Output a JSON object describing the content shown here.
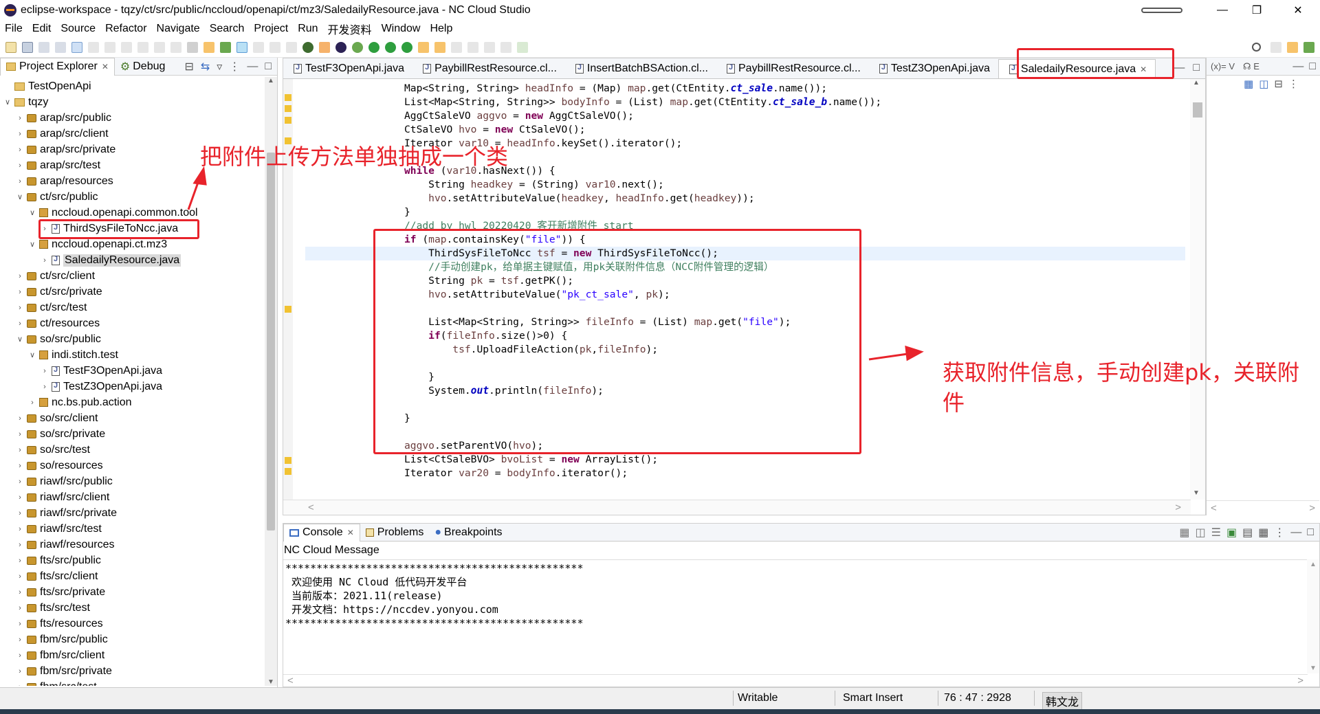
{
  "window": {
    "title": "eclipse-workspace - tqzy/ct/src/public/nccloud/openapi/ct/mz3/SaledailyResource.java - NC Cloud Studio"
  },
  "menu": [
    "File",
    "Edit",
    "Source",
    "Refactor",
    "Navigate",
    "Search",
    "Project",
    "Run",
    "开发资料",
    "Window",
    "Help"
  ],
  "left_panel": {
    "tabs": [
      "Project Explorer",
      "Debug"
    ],
    "tree": [
      {
        "label": "TestOpenApi",
        "icon": "project",
        "level": 0,
        "twist": ""
      },
      {
        "label": "tqzy",
        "icon": "project",
        "level": 0,
        "twist": "v"
      },
      {
        "label": "arap/src/public",
        "icon": "srcfolder",
        "level": 1,
        "twist": ">"
      },
      {
        "label": "arap/src/client",
        "icon": "srcfolder",
        "level": 1,
        "twist": ">"
      },
      {
        "label": "arap/src/private",
        "icon": "srcfolder",
        "level": 1,
        "twist": ">"
      },
      {
        "label": "arap/src/test",
        "icon": "srcfolder",
        "level": 1,
        "twist": ">"
      },
      {
        "label": "arap/resources",
        "icon": "srcfolder",
        "level": 1,
        "twist": ">"
      },
      {
        "label": "ct/src/public",
        "icon": "srcfolder",
        "level": 1,
        "twist": "v"
      },
      {
        "label": "nccloud.openapi.common.tool",
        "icon": "package",
        "level": 2,
        "twist": "v"
      },
      {
        "label": "ThirdSysFileToNcc.java",
        "icon": "java",
        "level": 3,
        "twist": ">"
      },
      {
        "label": "nccloud.openapi.ct.mz3",
        "icon": "package",
        "level": 2,
        "twist": "v"
      },
      {
        "label": "SaledailyResource.java",
        "icon": "java",
        "level": 3,
        "twist": ">",
        "selected": true
      },
      {
        "label": "ct/src/client",
        "icon": "srcfolder",
        "level": 1,
        "twist": ">"
      },
      {
        "label": "ct/src/private",
        "icon": "srcfolder",
        "level": 1,
        "twist": ">"
      },
      {
        "label": "ct/src/test",
        "icon": "srcfolder",
        "level": 1,
        "twist": ">"
      },
      {
        "label": "ct/resources",
        "icon": "srcfolder",
        "level": 1,
        "twist": ">"
      },
      {
        "label": "so/src/public",
        "icon": "srcfolder",
        "level": 1,
        "twist": "v"
      },
      {
        "label": "indi.stitch.test",
        "icon": "package",
        "level": 2,
        "twist": "v"
      },
      {
        "label": "TestF3OpenApi.java",
        "icon": "java",
        "level": 3,
        "twist": ">"
      },
      {
        "label": "TestZ3OpenApi.java",
        "icon": "java",
        "level": 3,
        "twist": ">"
      },
      {
        "label": "nc.bs.pub.action",
        "icon": "package",
        "level": 2,
        "twist": ">"
      },
      {
        "label": "so/src/client",
        "icon": "srcfolder",
        "level": 1,
        "twist": ">"
      },
      {
        "label": "so/src/private",
        "icon": "srcfolder",
        "level": 1,
        "twist": ">"
      },
      {
        "label": "so/src/test",
        "icon": "srcfolder",
        "level": 1,
        "twist": ">"
      },
      {
        "label": "so/resources",
        "icon": "srcfolder",
        "level": 1,
        "twist": ">"
      },
      {
        "label": "riawf/src/public",
        "icon": "srcfolder",
        "level": 1,
        "twist": ">"
      },
      {
        "label": "riawf/src/client",
        "icon": "srcfolder",
        "level": 1,
        "twist": ">"
      },
      {
        "label": "riawf/src/private",
        "icon": "srcfolder",
        "level": 1,
        "twist": ">"
      },
      {
        "label": "riawf/src/test",
        "icon": "srcfolder",
        "level": 1,
        "twist": ">"
      },
      {
        "label": "riawf/resources",
        "icon": "srcfolder",
        "level": 1,
        "twist": ">"
      },
      {
        "label": "fts/src/public",
        "icon": "srcfolder",
        "level": 1,
        "twist": ">"
      },
      {
        "label": "fts/src/client",
        "icon": "srcfolder",
        "level": 1,
        "twist": ">"
      },
      {
        "label": "fts/src/private",
        "icon": "srcfolder",
        "level": 1,
        "twist": ">"
      },
      {
        "label": "fts/src/test",
        "icon": "srcfolder",
        "level": 1,
        "twist": ">"
      },
      {
        "label": "fts/resources",
        "icon": "srcfolder",
        "level": 1,
        "twist": ">"
      },
      {
        "label": "fbm/src/public",
        "icon": "srcfolder",
        "level": 1,
        "twist": ">"
      },
      {
        "label": "fbm/src/client",
        "icon": "srcfolder",
        "level": 1,
        "twist": ">"
      },
      {
        "label": "fbm/src/private",
        "icon": "srcfolder",
        "level": 1,
        "twist": ">"
      },
      {
        "label": "fbm/src/test",
        "icon": "srcfolder",
        "level": 1,
        "twist": ">"
      }
    ]
  },
  "editor": {
    "tabs": [
      "TestF3OpenApi.java",
      "PaybillRestResource.cl...",
      "InsertBatchBSAction.cl...",
      "PaybillRestResource.cl...",
      "TestZ3OpenApi.java",
      "SaledailyResource.java"
    ],
    "active_tab": 5,
    "code": [
      [
        [
          "",
          "Map<String, String> "
        ],
        [
          "var",
          "headInfo"
        ],
        [
          "",
          " = (Map) "
        ],
        [
          "var",
          "map"
        ],
        [
          "",
          ".get(CtEntity."
        ],
        [
          "fld",
          "ct_sale"
        ],
        [
          "",
          ".name());"
        ]
      ],
      [
        [
          "",
          "List<Map<String, String>> "
        ],
        [
          "var",
          "bodyInfo"
        ],
        [
          "",
          " = (List) "
        ],
        [
          "var",
          "map"
        ],
        [
          "",
          ".get(CtEntity."
        ],
        [
          "fld",
          "ct_sale_b"
        ],
        [
          "",
          ".name());"
        ]
      ],
      [
        [
          "",
          "AggCtSaleVO "
        ],
        [
          "var",
          "aggvo"
        ],
        [
          "",
          " = "
        ],
        [
          "kw",
          "new"
        ],
        [
          "",
          " AggCtSaleVO();"
        ]
      ],
      [
        [
          "",
          "CtSaleVO "
        ],
        [
          "var",
          "hvo"
        ],
        [
          "",
          " = "
        ],
        [
          "kw",
          "new"
        ],
        [
          "",
          " CtSaleVO();"
        ]
      ],
      [
        [
          "",
          "Iterator "
        ],
        [
          "var",
          "var10"
        ],
        [
          "",
          " = "
        ],
        [
          "var",
          "headInfo"
        ],
        [
          "",
          ".keySet().iterator();"
        ]
      ],
      [
        [
          "",
          ""
        ]
      ],
      [
        [
          "kw",
          "while"
        ],
        [
          "",
          " ("
        ],
        [
          "var",
          "var10"
        ],
        [
          "",
          ".hasNext()) {"
        ]
      ],
      [
        [
          "",
          "    String "
        ],
        [
          "var",
          "headkey"
        ],
        [
          "",
          " = (String) "
        ],
        [
          "var",
          "var10"
        ],
        [
          "",
          ".next();"
        ]
      ],
      [
        [
          "",
          "    "
        ],
        [
          "var",
          "hvo"
        ],
        [
          "",
          ".setAttributeValue("
        ],
        [
          "var",
          "headkey"
        ],
        [
          "",
          ", "
        ],
        [
          "var",
          "headInfo"
        ],
        [
          "",
          ".get("
        ],
        [
          "var",
          "headkey"
        ],
        [
          "",
          "));"
        ]
      ],
      [
        [
          "",
          "}"
        ]
      ],
      [
        [
          "cm",
          "//add by hwl 20220420 客开新增附件 start"
        ]
      ],
      [
        [
          "kw",
          "if"
        ],
        [
          "",
          " ("
        ],
        [
          "var",
          "map"
        ],
        [
          "",
          ".containsKey("
        ],
        [
          "st",
          "\"file\""
        ],
        [
          "",
          ")) {"
        ]
      ],
      [
        [
          "",
          "    ThirdSysFileToNcc "
        ],
        [
          "var",
          "tsf"
        ],
        [
          "",
          " = "
        ],
        [
          "kw",
          "new"
        ],
        [
          "",
          " ThirdSysFileToNcc();"
        ]
      ],
      [
        [
          "cm",
          "    //手动创建pk，给单据主键赋值，用pk关联附件信息（NCC附件管理的逻辑）"
        ]
      ],
      [
        [
          "",
          "    String "
        ],
        [
          "var",
          "pk"
        ],
        [
          "",
          " = "
        ],
        [
          "var",
          "tsf"
        ],
        [
          "",
          ".getPK();"
        ]
      ],
      [
        [
          "",
          "    "
        ],
        [
          "var",
          "hvo"
        ],
        [
          "",
          ".setAttributeValue("
        ],
        [
          "st",
          "\"pk_ct_sale\""
        ],
        [
          "",
          ", "
        ],
        [
          "var",
          "pk"
        ],
        [
          "",
          ");"
        ]
      ],
      [
        [
          "",
          ""
        ]
      ],
      [
        [
          "",
          "    List<Map<String, String>> "
        ],
        [
          "var",
          "fileInfo"
        ],
        [
          "",
          " = (List) "
        ],
        [
          "var",
          "map"
        ],
        [
          "",
          ".get("
        ],
        [
          "st",
          "\"file\""
        ],
        [
          "",
          ");"
        ]
      ],
      [
        [
          "",
          "    "
        ],
        [
          "kw",
          "if"
        ],
        [
          "",
          "("
        ],
        [
          "var",
          "fileInfo"
        ],
        [
          "",
          ".size()>0) {"
        ]
      ],
      [
        [
          "",
          "        "
        ],
        [
          "var",
          "tsf"
        ],
        [
          "",
          ".UploadFileAction("
        ],
        [
          "var",
          "pk"
        ],
        [
          "",
          ","
        ],
        [
          "var",
          "fileInfo"
        ],
        [
          "",
          ");"
        ]
      ],
      [
        [
          "",
          ""
        ]
      ],
      [
        [
          "",
          "    }"
        ]
      ],
      [
        [
          "",
          "    System."
        ],
        [
          "fld",
          "out"
        ],
        [
          "",
          ".println("
        ],
        [
          "var",
          "fileInfo"
        ],
        [
          "",
          ");"
        ]
      ],
      [
        [
          "",
          ""
        ]
      ],
      [
        [
          "",
          "}"
        ]
      ],
      [
        [
          "",
          ""
        ]
      ],
      [
        [
          "var",
          "aggvo"
        ],
        [
          "",
          ".setParentVO("
        ],
        [
          "var",
          "hvo"
        ],
        [
          "",
          ");"
        ]
      ],
      [
        [
          "",
          "List<CtSaleBVO> "
        ],
        [
          "var",
          "bvoList"
        ],
        [
          "",
          " = "
        ],
        [
          "kw",
          "new"
        ],
        [
          "",
          " ArrayList();"
        ]
      ],
      [
        [
          "",
          "Iterator "
        ],
        [
          "var",
          "var20"
        ],
        [
          "",
          " = "
        ],
        [
          "var",
          "bodyInfo"
        ],
        [
          "",
          ".iterator();"
        ]
      ]
    ]
  },
  "console": {
    "tabs": [
      "Console",
      "Problems",
      "Breakpoints"
    ],
    "title": "NC Cloud Message",
    "lines": [
      "************************************************",
      " 欢迎使用 NC Cloud 低代码开发平台",
      " 当前版本：2021.11(release)",
      " 开发文档：https://nccdev.yonyou.com",
      "************************************************"
    ]
  },
  "status": {
    "writable": "Writable",
    "insert_mode": "Smart Insert",
    "position": "76 : 47 : 2928",
    "user": "韩文龙"
  },
  "annotations": {
    "top": "把附件上传方法单独抽成一个类",
    "right": "获取附件信息，手动创建pk，关联附件",
    "color": "#e8232b"
  }
}
